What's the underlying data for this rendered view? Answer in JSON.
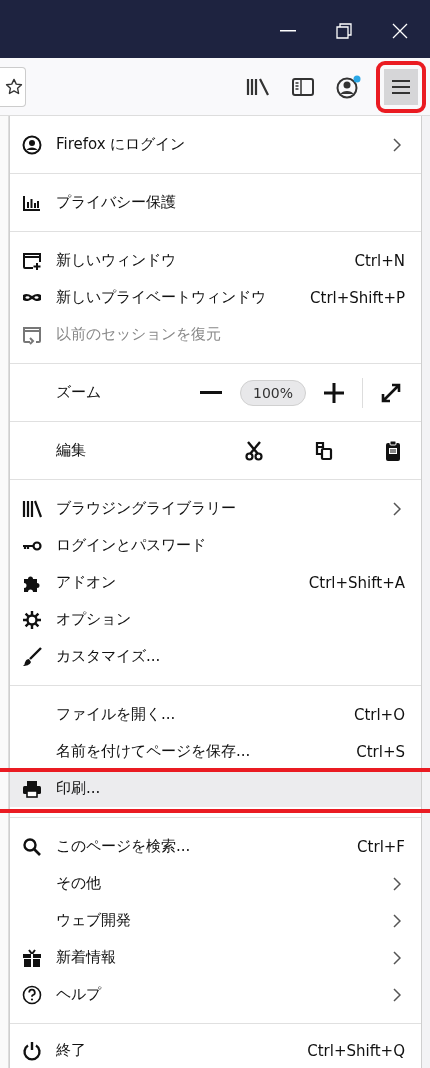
{
  "toolbar": {
    "account_notification": true,
    "menu_button": {
      "pressed": true,
      "callout": true
    }
  },
  "menu": [
    {
      "items": [
        {
          "kind": "item",
          "label": "Firefox にログイン",
          "submenu": true,
          "disabled": false,
          "hovered": false,
          "callout": false
        }
      ]
    },
    {
      "items": [
        {
          "kind": "item",
          "label": "プライバシー保護",
          "disabled": false,
          "hovered": false,
          "callout": false
        }
      ]
    },
    {
      "items": [
        {
          "kind": "item",
          "label": "新しいウィンドウ",
          "shortcut": "Ctrl+N",
          "disabled": false,
          "hovered": false,
          "callout": false
        },
        {
          "kind": "item",
          "label": "新しいプライベートウィンドウ",
          "shortcut": "Ctrl+Shift+P",
          "disabled": false,
          "hovered": false,
          "callout": false
        },
        {
          "kind": "item",
          "label": "以前のセッションを復元",
          "disabled": true,
          "hovered": false,
          "callout": false
        }
      ]
    },
    {
      "items": [
        {
          "kind": "zoom",
          "label": "ズーム",
          "value": "100%"
        }
      ]
    },
    {
      "items": [
        {
          "kind": "edit",
          "label": "編集"
        }
      ]
    },
    {
      "items": [
        {
          "kind": "item",
          "label": "ブラウジングライブラリー",
          "submenu": true,
          "disabled": false,
          "hovered": false,
          "callout": false
        },
        {
          "kind": "item",
          "label": "ログインとパスワード",
          "disabled": false,
          "hovered": false,
          "callout": false
        },
        {
          "kind": "item",
          "label": "アドオン",
          "shortcut": "Ctrl+Shift+A",
          "disabled": false,
          "hovered": false,
          "callout": false
        },
        {
          "kind": "item",
          "label": "オプション",
          "disabled": false,
          "hovered": false,
          "callout": false
        },
        {
          "kind": "item",
          "label": "カスタマイズ...",
          "disabled": false,
          "hovered": false,
          "callout": false
        }
      ]
    },
    {
      "items": [
        {
          "kind": "item",
          "label": "ファイルを開く...",
          "shortcut": "Ctrl+O",
          "disabled": false,
          "hovered": false,
          "callout": false
        },
        {
          "kind": "item",
          "label": "名前を付けてページを保存...",
          "shortcut": "Ctrl+S",
          "disabled": false,
          "hovered": false,
          "callout": false
        },
        {
          "kind": "item",
          "label": "印刷...",
          "disabled": false,
          "hovered": true,
          "callout": true
        }
      ]
    },
    {
      "items": [
        {
          "kind": "item",
          "label": "このページを検索...",
          "shortcut": "Ctrl+F",
          "disabled": false,
          "hovered": false,
          "callout": false
        },
        {
          "kind": "item",
          "label": "その他",
          "submenu": true,
          "disabled": false,
          "hovered": false,
          "callout": false
        },
        {
          "kind": "item",
          "label": "ウェブ開発",
          "submenu": true,
          "disabled": false,
          "hovered": false,
          "callout": false
        },
        {
          "kind": "item",
          "label": "新着情報",
          "submenu": true,
          "disabled": false,
          "hovered": false,
          "callout": false
        },
        {
          "kind": "item",
          "label": "ヘルプ",
          "submenu": true,
          "disabled": false,
          "hovered": false,
          "callout": false
        }
      ]
    },
    {
      "items": [
        {
          "kind": "item",
          "label": "終了",
          "shortcut": "Ctrl+Shift+Q",
          "disabled": false,
          "hovered": false,
          "callout": false
        }
      ]
    }
  ]
}
